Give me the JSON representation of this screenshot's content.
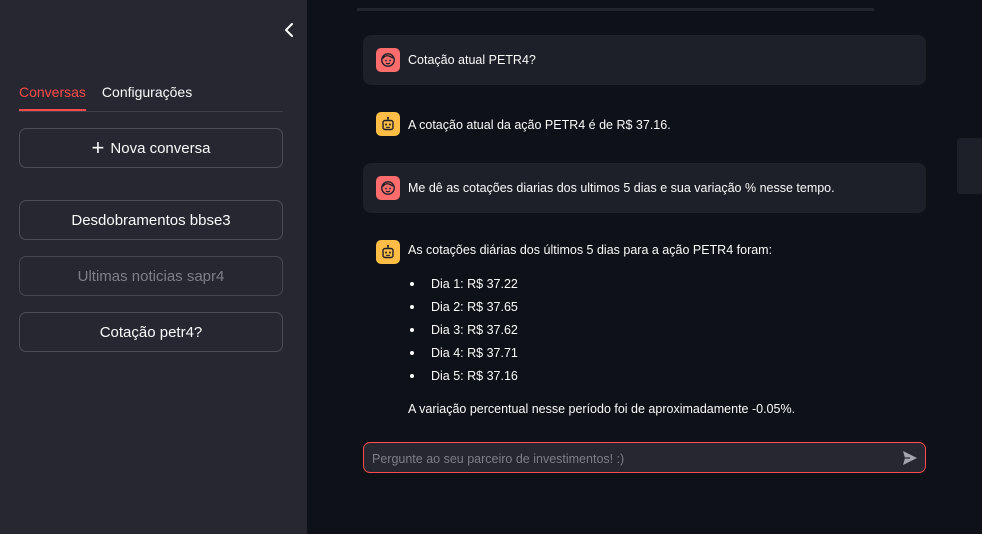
{
  "sidebar": {
    "tabs": [
      {
        "label": "Conversas",
        "active": true
      },
      {
        "label": "Configurações",
        "active": false
      }
    ],
    "new_chat_label": "Nova conversa",
    "conversations": [
      {
        "label": "Desdobramentos bbse3",
        "enabled": true
      },
      {
        "label": "Ultimas noticias sapr4",
        "enabled": false
      },
      {
        "label": "Cotação petr4?",
        "enabled": true
      }
    ]
  },
  "messages": [
    {
      "role": "user",
      "text": "Cotação atual PETR4?"
    },
    {
      "role": "assistant",
      "text": "A cotação atual da ação PETR4 é de R$ 37.16."
    },
    {
      "role": "user",
      "text": "Me dê as cotações diarias dos ultimos 5 dias e sua variação % nesse tempo."
    },
    {
      "role": "assistant",
      "intro": "As cotações diárias dos últimos 5 dias para a ação PETR4 foram:",
      "items": [
        "Dia 1: R$ 37.22",
        "Dia 2: R$ 37.65",
        "Dia 3: R$ 37.62",
        "Dia 4: R$ 37.71",
        "Dia 5: R$ 37.16"
      ],
      "conclusion": "A variação percentual nesse período foi de aproximadamente -0.05%."
    }
  ],
  "chat_input": {
    "placeholder": "Pergunte ao seu parceiro de investimentos! :)",
    "value": ""
  },
  "colors": {
    "accent": "#ff4b4b",
    "sidebar_bg": "#262730",
    "main_bg": "#0e1117",
    "user_avatar": "#ff6c6c",
    "bot_avatar": "#ffbd45"
  },
  "icons": {
    "collapse": "chevron-left-icon",
    "new_chat": "plus-icon",
    "user_avatar": "face-icon",
    "bot_avatar": "robot-icon",
    "send": "send-icon"
  }
}
